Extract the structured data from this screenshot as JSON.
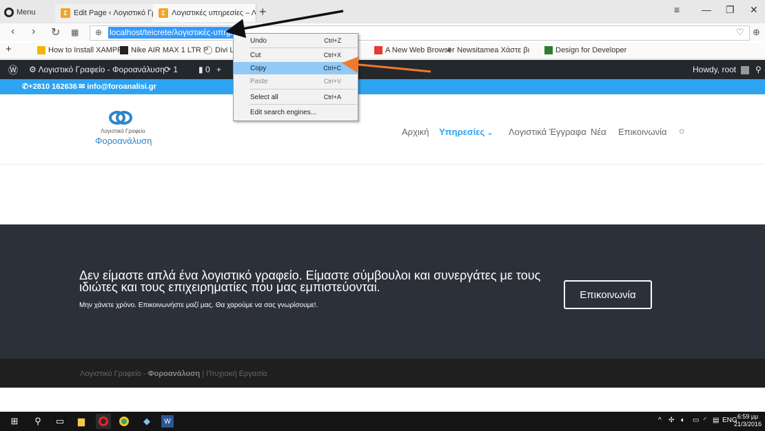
{
  "browser": {
    "menu_label": "Menu",
    "tabs": [
      {
        "label": "Edit Page ‹ Λογιστικό Γραφ"
      },
      {
        "label": "Λογιστικές υπηρεσίες – Λο"
      }
    ],
    "new_tab": "+",
    "url": "localhost/teicrete/λογιστικές-υπηρεσ",
    "bookmarks": [
      {
        "label": "How to Install XAMPP"
      },
      {
        "label": "Nike AIR MAX 1 LTR P"
      },
      {
        "label": "Divi L"
      },
      {
        "label": "A New Web Browser"
      },
      {
        "label": "Newsitamea Χάστε βι"
      },
      {
        "label": "Design for Developer"
      }
    ],
    "window_controls": {
      "minimize": "—",
      "maximize": "❐",
      "close": "✕",
      "menu": "≡"
    }
  },
  "context_menu": {
    "items": [
      {
        "label": "Undo",
        "shortcut": "Ctrl+Z",
        "disabled": false
      },
      {
        "label": "Cut",
        "shortcut": "Ctrl+X",
        "disabled": false
      },
      {
        "label": "Copy",
        "shortcut": "Ctrl+C",
        "disabled": false
      },
      {
        "label": "Paste",
        "shortcut": "Ctrl+V",
        "disabled": true
      },
      {
        "label": "Select all",
        "shortcut": "Ctrl+A",
        "disabled": false
      },
      {
        "label": "Edit search engines...",
        "shortcut": "",
        "disabled": false
      }
    ]
  },
  "admin_bar": {
    "site_name": "Λογιστικό Γραφείο - Φοροανάλυση",
    "updates_count": "1",
    "comments_count": "0",
    "howdy": "Howdy, root"
  },
  "top_bar": {
    "phone": "+2810 162636",
    "email": "info@foroanalisi.gr"
  },
  "header": {
    "logo_line1": "Λογιστικό Γραφείο",
    "logo_line2": "Φοροανάλυση",
    "nav": [
      {
        "label": "Αρχική"
      },
      {
        "label": "Υπηρεσίες"
      },
      {
        "label": "Λογιστικά Έγγραφα"
      },
      {
        "label": "Νέα"
      },
      {
        "label": "Επικοινωνία"
      }
    ]
  },
  "cta": {
    "heading": "Δεν είμαστε απλά ένα λογιστικό γραφείο. Είμαστε σύμβουλοι και συνεργάτες με τους ιδιώτες και τους επιχειρηματίες που μας εμπιστεύονται.",
    "subtext": "Μην χάνετε χρόνο. Επικοινωνήστε μαζί μας. Θα χαρούμε να σας γνωρίσουμε!.",
    "button": "Επικοινωνία"
  },
  "footer": {
    "prefix": "Λογιστικό Γραφείο - ",
    "brand": "Φοροανάλυση",
    "suffix": " | Πτυχιακή Εργασία"
  },
  "taskbar": {
    "lang": "ENG",
    "time": "6:59 μμ",
    "date": "21/3/2016"
  },
  "colors": {
    "accent": "#2ea3f2",
    "admin_bar": "#23282d",
    "cta_bg": "#2c3039",
    "footer_bg": "#1f1f1f",
    "annotation_arrow": "#f07a2a"
  }
}
